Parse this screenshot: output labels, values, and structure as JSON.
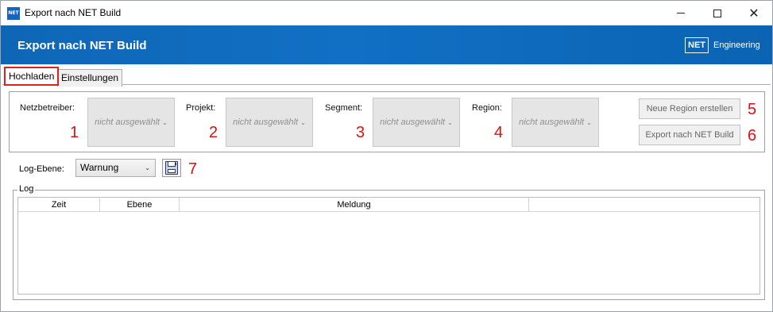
{
  "window": {
    "title": "Export nach NET Build",
    "icon": "NET",
    "controls": [
      "minimize",
      "maximize",
      "close"
    ]
  },
  "header": {
    "title": "Export nach NET Build",
    "logo_box": "NET",
    "logo_text": "Engineering"
  },
  "tabs": [
    {
      "label": "Hochladen",
      "active": true
    },
    {
      "label": "Einstellungen",
      "active": false
    }
  ],
  "fields": [
    {
      "label": "Netzbetreiber:",
      "value": "nicht ausgewählt",
      "number": "1"
    },
    {
      "label": "Projekt:",
      "value": "nicht ausgewählt",
      "number": "2"
    },
    {
      "label": "Segment:",
      "value": "nicht ausgewählt",
      "number": "3"
    },
    {
      "label": "Region:",
      "value": "nicht ausgewählt",
      "number": "4"
    }
  ],
  "buttons": [
    {
      "label": "Neue Region erstellen",
      "number": "5"
    },
    {
      "label": "Export nach NET Build",
      "number": "6"
    }
  ],
  "log_level": {
    "label": "Log-Ebene:",
    "value": "Warnung",
    "save_number": "7"
  },
  "log": {
    "legend": "Log",
    "columns": [
      "Zeit",
      "Ebene",
      "Meldung"
    ],
    "rows": []
  },
  "colors": {
    "header_blue": "#1170c4",
    "annotation_red": "#e01010"
  }
}
